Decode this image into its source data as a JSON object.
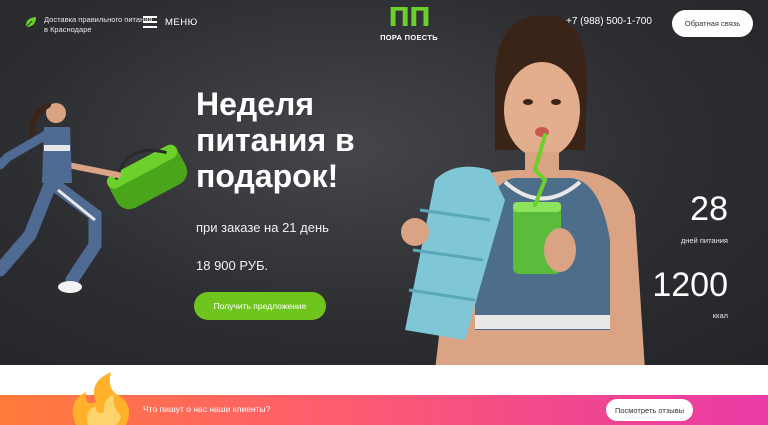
{
  "header": {
    "delivery_text": "Доставка правильного питания в Краснодаре",
    "menu_label": "МЕНЮ",
    "logo_mark": "ПП",
    "logo_name": "ПОРА ПОЕСТЬ",
    "phone": "+7 (988) 500-1-700",
    "callback_label": "Обратная связь"
  },
  "hero": {
    "title": "Неделя питания в подарок!",
    "subtitle": "при заказе на 21 день",
    "price": "18 900 РУБ.",
    "cta_label": "Получить предложение"
  },
  "stats": [
    {
      "value": "28",
      "label": "дней питания"
    },
    {
      "value": "1200",
      "label": "ккал"
    }
  ],
  "reviews_bar": {
    "question": "Что пишут о нас наши клиенты?",
    "button_label": "Посмотреть отзывы"
  },
  "colors": {
    "accent_green": "#6fc51d",
    "bar_gradient_start": "#ff7b3a",
    "bar_gradient_end": "#e93aa6"
  }
}
